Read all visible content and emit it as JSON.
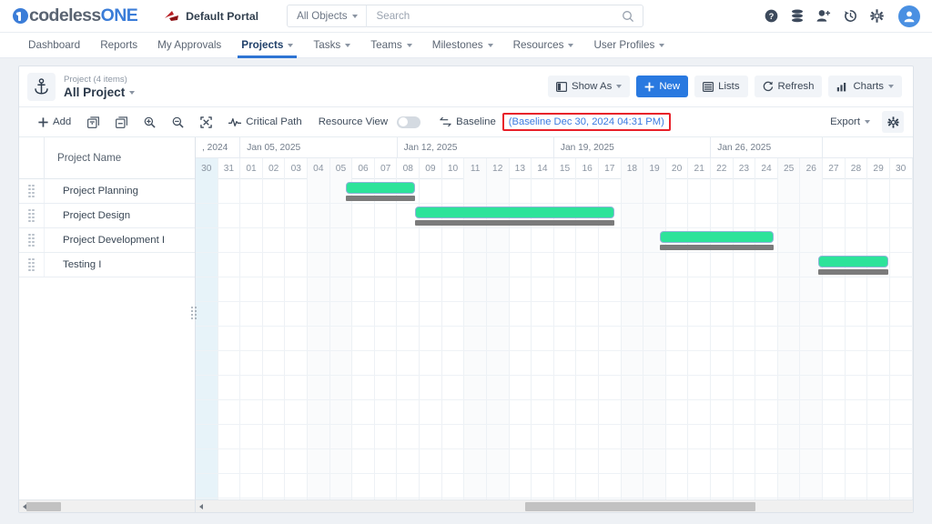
{
  "header": {
    "logo_text_dark": "codeless",
    "logo_text_blue": "ONE",
    "portal_label": "Default Portal",
    "portal_icon": "portal-logo-icon",
    "search": {
      "scope_label": "All Objects",
      "placeholder": "Search",
      "value": "",
      "search_icon": "search-icon"
    },
    "icons": [
      {
        "name": "help-icon",
        "glyph": "?"
      },
      {
        "name": "database-icon",
        "glyph": ""
      },
      {
        "name": "add-user-icon",
        "glyph": ""
      },
      {
        "name": "history-icon",
        "glyph": ""
      },
      {
        "name": "settings-gear-icon",
        "glyph": ""
      },
      {
        "name": "user-avatar",
        "glyph": ""
      }
    ]
  },
  "nav": {
    "items": [
      {
        "label": "Dashboard",
        "caret": false,
        "active": false
      },
      {
        "label": "Reports",
        "caret": false,
        "active": false
      },
      {
        "label": "My Approvals",
        "caret": false,
        "active": false
      },
      {
        "label": "Projects",
        "caret": true,
        "active": true
      },
      {
        "label": "Tasks",
        "caret": true,
        "active": false
      },
      {
        "label": "Teams",
        "caret": true,
        "active": false
      },
      {
        "label": "Milestones",
        "caret": true,
        "active": false
      },
      {
        "label": "Resources",
        "caret": true,
        "active": false
      },
      {
        "label": "User Profiles",
        "caret": true,
        "active": false
      }
    ]
  },
  "card_header": {
    "anchor_icon": "anchor-icon",
    "subtitle": "Project (4 items)",
    "title": "All Project",
    "buttons": [
      {
        "name": "show-as-button",
        "label": "Show As",
        "icon": "panel-icon",
        "caret": true,
        "primary": false
      },
      {
        "name": "new-button",
        "label": "New",
        "icon": "plus-icon",
        "caret": false,
        "primary": true
      },
      {
        "name": "lists-button",
        "label": "Lists",
        "icon": "list-icon",
        "caret": false,
        "primary": false
      },
      {
        "name": "refresh-button",
        "label": "Refresh",
        "icon": "refresh-icon",
        "caret": false,
        "primary": false
      },
      {
        "name": "charts-button",
        "label": "Charts",
        "icon": "chart-icon",
        "caret": true,
        "primary": false
      }
    ]
  },
  "toolbar": {
    "add_label": "Add",
    "critical_path_label": "Critical Path",
    "resource_view_label": "Resource View",
    "resource_view_on": false,
    "baseline_label": "Baseline",
    "baseline_note": "(Baseline Dec 30, 2024 04:31 PM)",
    "baseline_note_highlight_color": "#e8202a",
    "baseline_note_text_color": "#3b7ae0",
    "export_label": "Export",
    "icons": [
      {
        "name": "add-icon"
      },
      {
        "name": "expand-all-icon"
      },
      {
        "name": "collapse-all-icon"
      },
      {
        "name": "zoom-in-icon"
      },
      {
        "name": "zoom-out-icon"
      },
      {
        "name": "fit-screen-icon"
      },
      {
        "name": "critical-path-icon"
      },
      {
        "name": "baseline-icon"
      },
      {
        "name": "settings-gear-icon"
      }
    ]
  },
  "gantt": {
    "column_header": "Project Name",
    "rows": [
      {
        "name": "Project Planning"
      },
      {
        "name": "Project Design"
      },
      {
        "name": "Project Development I"
      },
      {
        "name": "Testing I"
      }
    ],
    "week_headers": [
      {
        "label": ", 2024",
        "span_days": 2
      },
      {
        "label": "Jan 05, 2025",
        "span_days": 7
      },
      {
        "label": "Jan 12, 2025",
        "span_days": 7
      },
      {
        "label": "Jan 19, 2025",
        "span_days": 7
      },
      {
        "label": "Jan 26, 2025",
        "span_days": 5
      }
    ],
    "days": [
      {
        "label": "30",
        "weekend": false,
        "today": true
      },
      {
        "label": "31",
        "weekend": false,
        "today": false
      },
      {
        "label": "01",
        "weekend": false,
        "today": false
      },
      {
        "label": "02",
        "weekend": false,
        "today": false
      },
      {
        "label": "03",
        "weekend": false,
        "today": false
      },
      {
        "label": "04",
        "weekend": true,
        "today": false
      },
      {
        "label": "05",
        "weekend": true,
        "today": false
      },
      {
        "label": "06",
        "weekend": false,
        "today": false
      },
      {
        "label": "07",
        "weekend": false,
        "today": false
      },
      {
        "label": "08",
        "weekend": false,
        "today": false
      },
      {
        "label": "09",
        "weekend": false,
        "today": false
      },
      {
        "label": "10",
        "weekend": false,
        "today": false
      },
      {
        "label": "11",
        "weekend": true,
        "today": false
      },
      {
        "label": "12",
        "weekend": true,
        "today": false
      },
      {
        "label": "13",
        "weekend": false,
        "today": false
      },
      {
        "label": "14",
        "weekend": false,
        "today": false
      },
      {
        "label": "15",
        "weekend": false,
        "today": false
      },
      {
        "label": "16",
        "weekend": false,
        "today": false
      },
      {
        "label": "17",
        "weekend": false,
        "today": false
      },
      {
        "label": "18",
        "weekend": true,
        "today": false
      },
      {
        "label": "19",
        "weekend": true,
        "today": false
      },
      {
        "label": "20",
        "weekend": false,
        "today": false
      },
      {
        "label": "21",
        "weekend": false,
        "today": false
      },
      {
        "label": "22",
        "weekend": false,
        "today": false
      },
      {
        "label": "23",
        "weekend": false,
        "today": false
      },
      {
        "label": "24",
        "weekend": false,
        "today": false
      },
      {
        "label": "25",
        "weekend": true,
        "today": false
      },
      {
        "label": "26",
        "weekend": true,
        "today": false
      },
      {
        "label": "27",
        "weekend": false,
        "today": false
      },
      {
        "label": "28",
        "weekend": false,
        "today": false
      },
      {
        "label": "29",
        "weekend": false,
        "today": false
      },
      {
        "label": "30",
        "weekend": false,
        "today": false
      }
    ],
    "bar_color": "#2de39a",
    "baseline_color": "#7b7b7b",
    "bars": [
      {
        "row": 0,
        "start_day_index": 6.7,
        "end_day_index": 9.8,
        "baseline_start": 6.7,
        "baseline_end": 9.8
      },
      {
        "row": 1,
        "start_day_index": 9.8,
        "end_day_index": 18.7,
        "baseline_start": 9.8,
        "baseline_end": 18.7
      },
      {
        "row": 2,
        "start_day_index": 20.7,
        "end_day_index": 25.8,
        "baseline_start": 20.7,
        "baseline_end": 25.8
      },
      {
        "row": 3,
        "start_day_index": 27.8,
        "end_day_index": 30.9,
        "baseline_start": 27.8,
        "baseline_end": 30.9
      }
    ]
  },
  "scrollbars": {
    "left": {
      "thumb_start_pct": 4,
      "thumb_width_pct": 20
    },
    "right": {
      "thumb_start_pct": 46,
      "thumb_width_pct": 32
    }
  }
}
